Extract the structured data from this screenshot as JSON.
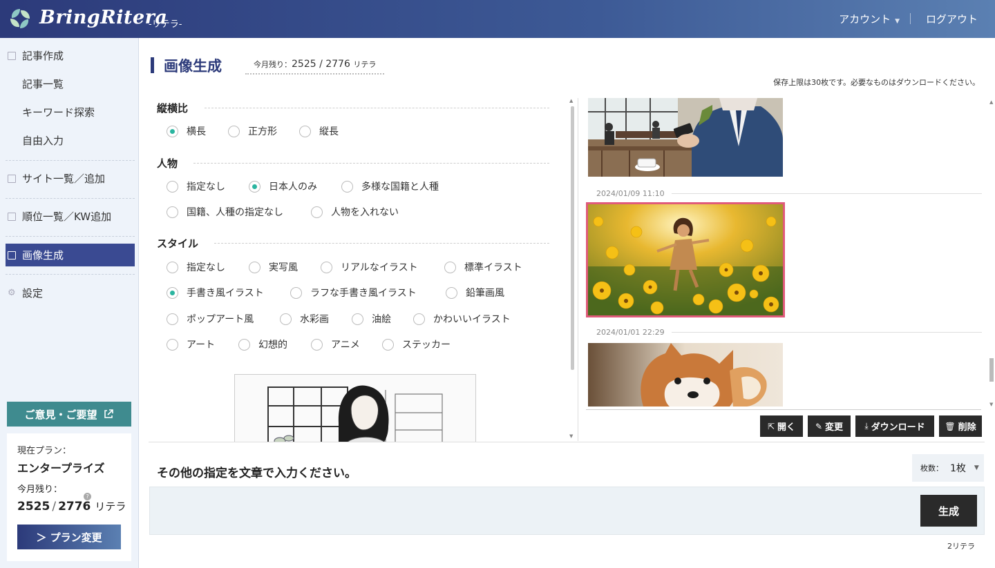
{
  "header": {
    "brand": "BringRitera",
    "brand_sub": "-リテラ-",
    "account": "アカウント",
    "logout": "ログアウト"
  },
  "sidebar": {
    "items": [
      {
        "label": "記事作成"
      },
      {
        "label": "記事一覧"
      },
      {
        "label": "キーワード探索"
      },
      {
        "label": "自由入力"
      },
      {
        "label": "サイト一覧／追加"
      },
      {
        "label": "順位一覧／KW追加"
      },
      {
        "label": "画像生成"
      },
      {
        "label": "設定"
      }
    ],
    "feedback": "ご意見・ご要望",
    "plan_label": "現在プラン：",
    "plan_name": "エンタープライズ",
    "remain_label": "今月残り：",
    "remain_used": "2525",
    "remain_total": "2776",
    "remain_unit": "リテラ",
    "plan_button": "＞ プラン変更"
  },
  "main": {
    "title": "画像生成",
    "remain_label": "今月残り：",
    "remain_value": "2525 / 2776",
    "remain_unit": "リテラ",
    "notice": "保存上限は30枚です。必要なものはダウンロードください。"
  },
  "form": {
    "aspect": {
      "title": "縦横比",
      "options": [
        "横長",
        "正方形",
        "縦長"
      ]
    },
    "person": {
      "title": "人物",
      "options": [
        "指定なし",
        "日本人のみ",
        "多様な国籍と人種",
        "国籍、人種の指定なし",
        "人物を入れない"
      ]
    },
    "style": {
      "title": "スタイル",
      "options": [
        "指定なし",
        "実写風",
        "リアルなイラスト",
        "標準イラスト",
        "手書き風イラスト",
        "ラフな手書き風イラスト",
        "鉛筆画風",
        "ポップアート風",
        "水彩画",
        "油絵",
        "かわいいイラスト",
        "アート",
        "幻想的",
        "アニメ",
        "ステッカー"
      ]
    }
  },
  "gallery": {
    "dates": [
      "2024/01/09 11:10",
      "2024/01/01 22:29"
    ],
    "actions": {
      "open": "開く",
      "edit": "変更",
      "download": "ダウンロード",
      "delete": "削除"
    }
  },
  "prompt": {
    "label": "その他の指定を文章で入力ください。",
    "count_label": "枚数：",
    "count_value": "1枚",
    "generate": "生成",
    "cost": "2リテラ"
  },
  "colors": {
    "brand": "#2c3a7a",
    "accent": "#2bb5a0",
    "feedback": "#3f8b8f",
    "selected_border": "#e05a7a"
  }
}
